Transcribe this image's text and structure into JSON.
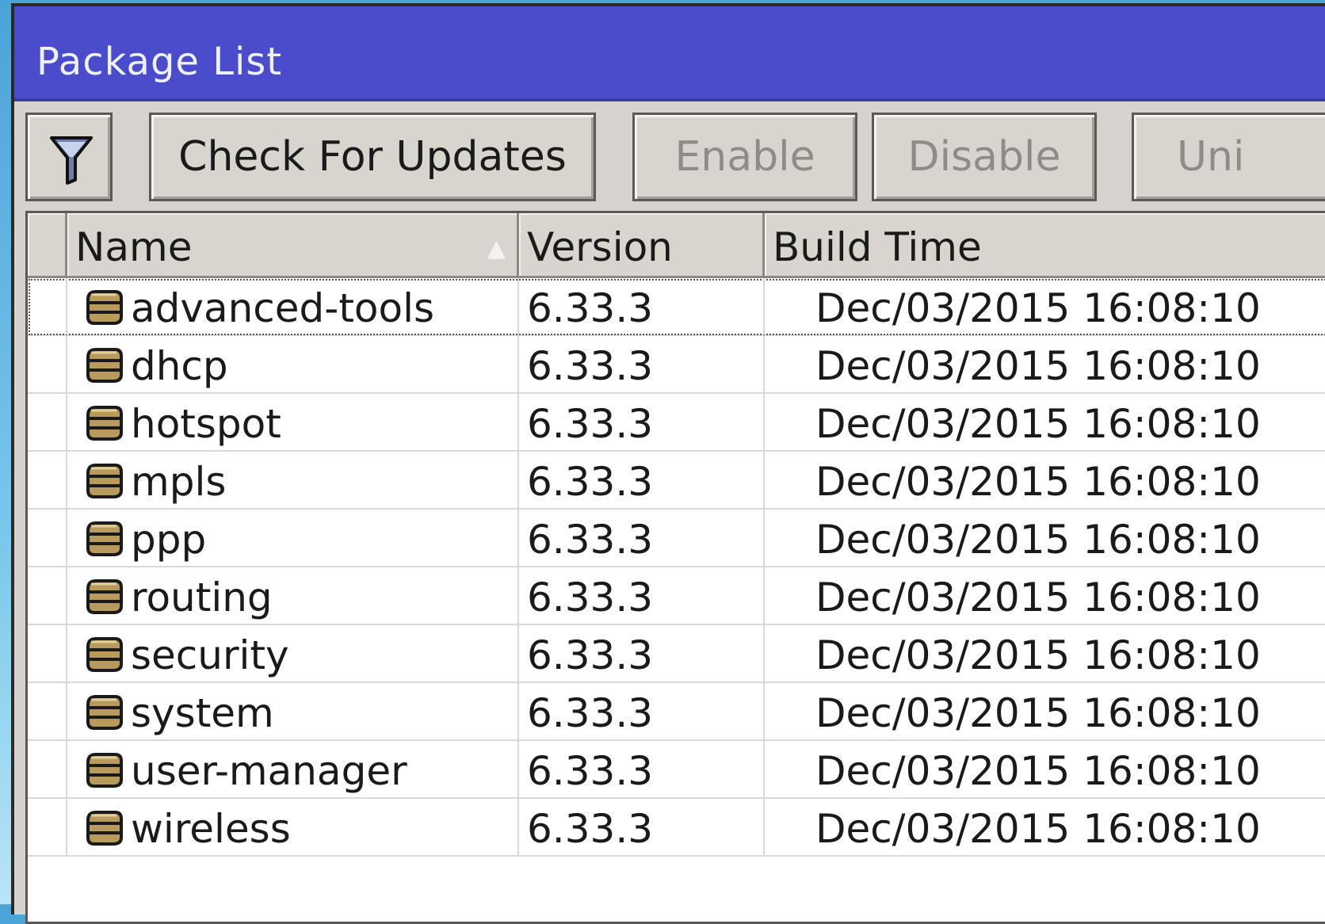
{
  "window": {
    "title": "Package List"
  },
  "toolbar": {
    "filter_icon": "filter-icon",
    "check_updates_label": "Check For Updates",
    "enable_label": "Enable",
    "disable_label": "Disable",
    "uninstall_label": "Uni"
  },
  "table": {
    "columns": [
      "Name",
      "Version",
      "Build Time"
    ],
    "sort_indicator": "▲",
    "rows": [
      {
        "name": "advanced-tools",
        "version": "6.33.3",
        "build_time": "Dec/03/2015 16:08:10"
      },
      {
        "name": "dhcp",
        "version": "6.33.3",
        "build_time": "Dec/03/2015 16:08:10"
      },
      {
        "name": "hotspot",
        "version": "6.33.3",
        "build_time": "Dec/03/2015 16:08:10"
      },
      {
        "name": "mpls",
        "version": "6.33.3",
        "build_time": "Dec/03/2015 16:08:10"
      },
      {
        "name": "ppp",
        "version": "6.33.3",
        "build_time": "Dec/03/2015 16:08:10"
      },
      {
        "name": "routing",
        "version": "6.33.3",
        "build_time": "Dec/03/2015 16:08:10"
      },
      {
        "name": "security",
        "version": "6.33.3",
        "build_time": "Dec/03/2015 16:08:10"
      },
      {
        "name": "system",
        "version": "6.33.3",
        "build_time": "Dec/03/2015 16:08:10"
      },
      {
        "name": "user-manager",
        "version": "6.33.3",
        "build_time": "Dec/03/2015 16:08:10"
      },
      {
        "name": "wireless",
        "version": "6.33.3",
        "build_time": "Dec/03/2015 16:08:10"
      }
    ]
  },
  "colors": {
    "titlebar": "#4a4ccb",
    "window_bg": "#d6d3ce",
    "disabled_text": "#8f8c87"
  }
}
